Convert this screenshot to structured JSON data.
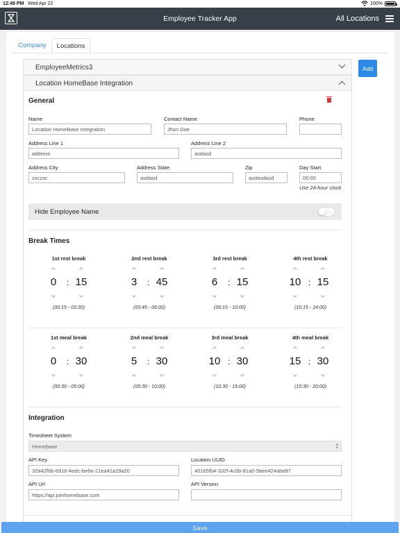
{
  "status_bar": {
    "time": "12:48 PM",
    "date": "Wed Apr 22",
    "battery": "100%"
  },
  "navbar": {
    "title": "Employee Tracker App",
    "location_selector": "All Locations",
    "logo_icon": "hourglass-icon",
    "menu_icon": "hamburger-menu-icon"
  },
  "tabs": [
    {
      "label": "Company"
    },
    {
      "label": "Locations"
    }
  ],
  "add_button": "Add",
  "accordion": [
    {
      "title": "EmployeeMetrics3"
    },
    {
      "title": "Location HomeBase Integration"
    }
  ],
  "general": {
    "title": "General",
    "name": {
      "label": "Name",
      "value": "Location HomeBase Integration"
    },
    "contact_name": {
      "label": "Contact Name",
      "value": "Jhon Doe"
    },
    "phone": {
      "label": "Phone",
      "value": ""
    },
    "address1": {
      "label": "Address Line 1",
      "value": "address"
    },
    "address2": {
      "label": "Address Line 2",
      "value": "asdasd"
    },
    "city": {
      "label": "Address City",
      "value": "zxczxc"
    },
    "state": {
      "label": "Address State",
      "value": "asdasd"
    },
    "zip": {
      "label": "Zip",
      "value": "asdasdasd"
    },
    "day_start": {
      "label": "Day Start",
      "value": "00:00",
      "hint": "Use 24-hour clock"
    },
    "hide_employee_name": {
      "label": "Hide Employee Name",
      "enabled": false
    }
  },
  "break_times": {
    "title": "Break Times",
    "rest": [
      {
        "label": "1st rest break",
        "hours": "0",
        "minutes": "15",
        "range": "(00:15 - 03:30)"
      },
      {
        "label": "2nd rest break",
        "hours": "3",
        "minutes": "45",
        "range": "(03:45 - 06:00)"
      },
      {
        "label": "3rd rest break",
        "hours": "6",
        "minutes": "15",
        "range": "(06:15 - 10:00)"
      },
      {
        "label": "4th rest break",
        "hours": "10",
        "minutes": "15",
        "range": "(10:15 - 14:00)"
      }
    ],
    "meal": [
      {
        "label": "1st meal break",
        "hours": "0",
        "minutes": "30",
        "range": "(00:30 - 05:00)"
      },
      {
        "label": "2nd meal break",
        "hours": "5",
        "minutes": "30",
        "range": "(05:30 - 10:00)"
      },
      {
        "label": "3rd meal break",
        "hours": "10",
        "minutes": "30",
        "range": "(10:30 - 15:00)"
      },
      {
        "label": "4th meal break",
        "hours": "15",
        "minutes": "30",
        "range": "(15:30 - 20:00)"
      }
    ]
  },
  "integration": {
    "title": "Integration",
    "timesheet_system": {
      "label": "Timesheet System",
      "value": "Homebase"
    },
    "api_key": {
      "label": "API Key",
      "value": "32a42f6b-6916-4edc-be6e-21ea41a29a20"
    },
    "location_uuid": {
      "label": "Location UUID",
      "value": "40165fb4-332f-4c0b-81a0-5bee424abe87"
    },
    "api_url": {
      "label": "API Url",
      "value": "https://api.joinhomebase.com"
    },
    "api_version": {
      "label": "API Version",
      "value": ""
    }
  },
  "save_button": "Save",
  "colors": {
    "navbar": "#374048",
    "accent": "#2e8ae6",
    "delete": "#d9363e"
  }
}
